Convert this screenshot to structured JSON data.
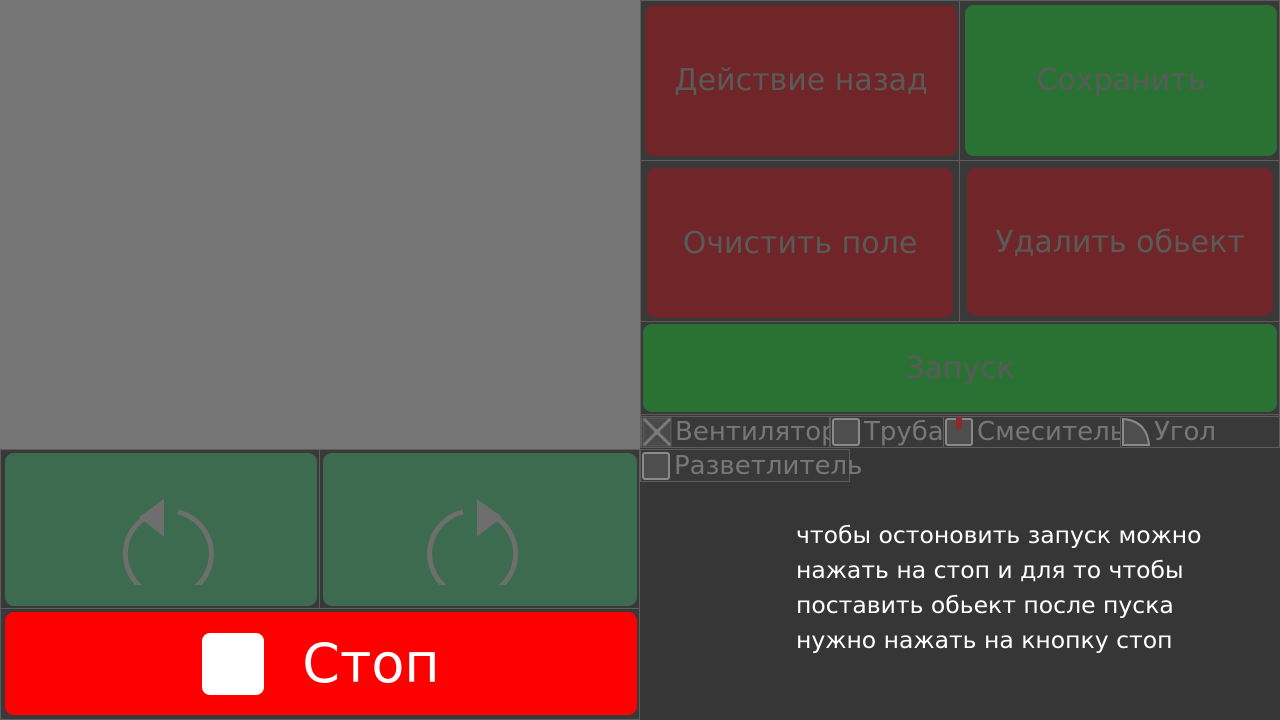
{
  "actions": {
    "undo_label": "Действие назад",
    "save_label": "Сохранить",
    "clear_label": "Очистить поле",
    "delete_label": "Удалить обьект",
    "run_label": "Запуск"
  },
  "palette": {
    "items": [
      {
        "label": "Вентилятор",
        "icon": "fan-icon"
      },
      {
        "label": "Труба",
        "icon": "pipe-icon"
      },
      {
        "label": "Смеситель",
        "icon": "mixer-icon"
      },
      {
        "label": "Угол",
        "icon": "corner-icon"
      },
      {
        "label": "Разветлитель",
        "icon": "splitter-icon"
      }
    ]
  },
  "rotation": {
    "left_icon": "rotate-left-icon",
    "right_icon": "rotate-right-icon"
  },
  "stop": {
    "label": "Стоп",
    "icon": "stop-square-icon"
  },
  "help_text": [
    "чтобы остоновить запуск можно",
    "нажать на стоп и для то чтобы",
    "поставить обьект после пуска",
    "нужно нажать на кнопку стоп"
  ],
  "colors": {
    "danger": "#702628",
    "success": "#2a7233",
    "stop": "#ff0000",
    "rotate": "#3d6b4f"
  }
}
